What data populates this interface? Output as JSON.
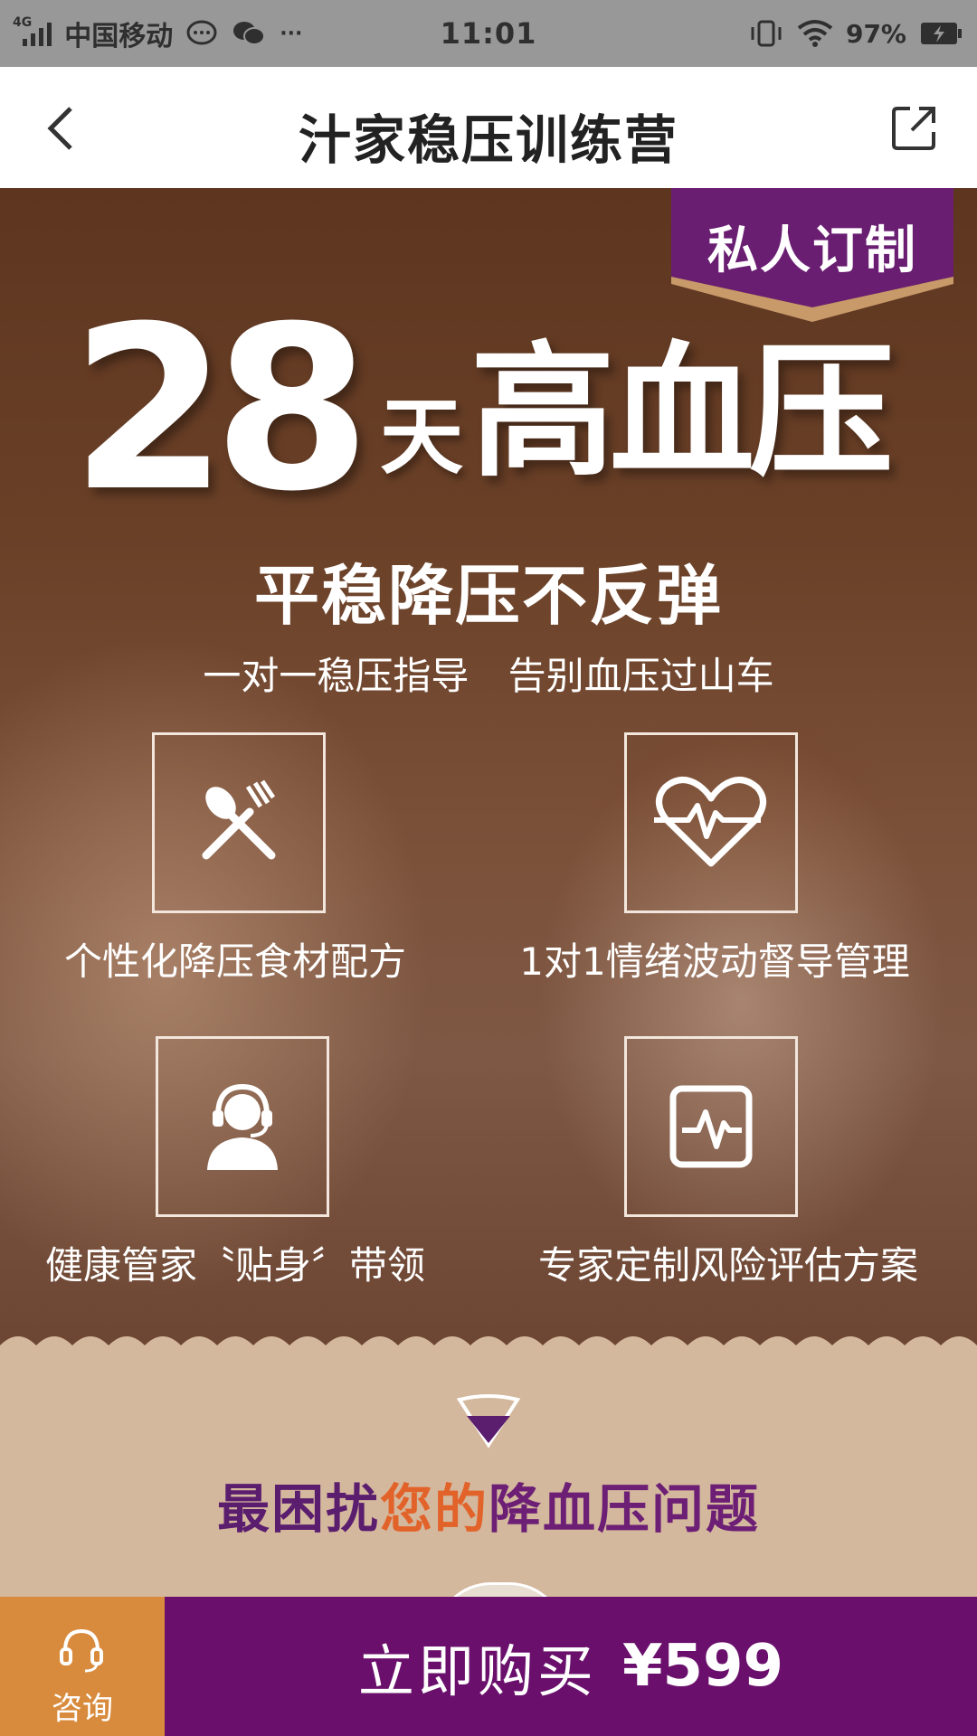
{
  "status_bar": {
    "network": "4G",
    "carrier": "中国移动",
    "more": "···",
    "time": "11:01",
    "battery": "97%"
  },
  "navbar": {
    "title": "汁家稳压训练营"
  },
  "hero": {
    "badge": "私人订制",
    "headline_number": "28",
    "headline_day": "天",
    "headline_text": "高血压",
    "subtitle": "平稳降压不反弹",
    "tagline": "一对一稳压指导 告别血压过山车",
    "features": [
      {
        "icon": "fork-spoon-icon",
        "label": "个性化降压食材配方"
      },
      {
        "icon": "heartbeat-icon",
        "label": "1对1情绪波动督导管理"
      },
      {
        "icon": "headset-person-icon",
        "label": "健康管家〝贴身〞带领"
      },
      {
        "icon": "monitor-pulse-icon",
        "label": "专家定制风险评估方案"
      }
    ]
  },
  "problems": {
    "heading_part1": "最困扰",
    "heading_part2": "您的",
    "heading_part3": "降血压问题"
  },
  "bottom_bar": {
    "consult_label": "咨询",
    "buy_label": "立即购买",
    "price": "¥599"
  },
  "colors": {
    "status_bar": "#989898",
    "hero_brown": "#6a4027",
    "badge_purple": "#6a1e72",
    "section_beige": "#d4b89d",
    "consult_orange": "#d98b3d",
    "buy_purple": "#6a0f6c"
  }
}
